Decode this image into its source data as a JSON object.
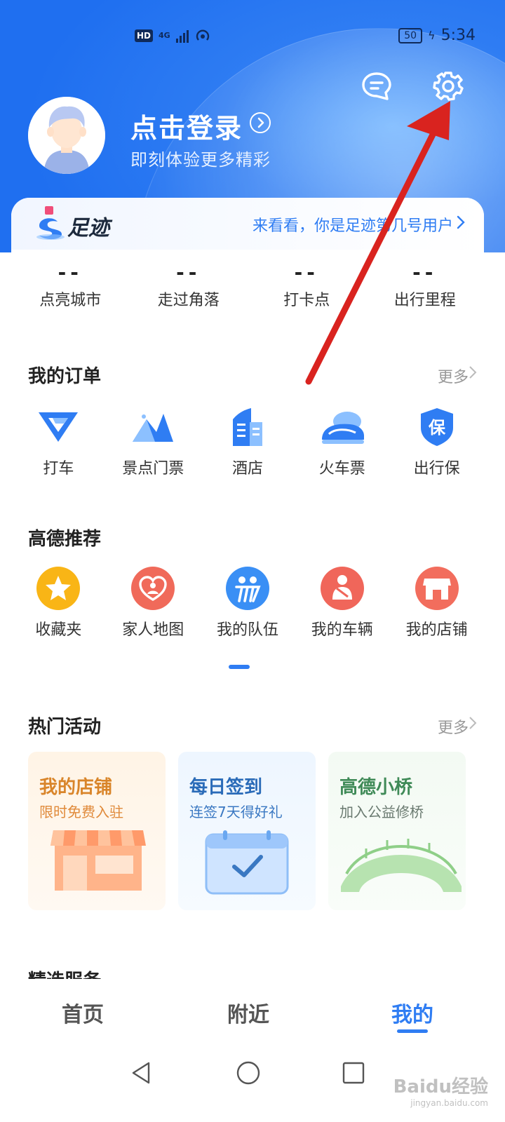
{
  "status_bar": {
    "time": "5:34",
    "battery": "50",
    "hd": "HD",
    "network": "4G"
  },
  "header": {
    "login_title": "点击登录",
    "login_subtitle": "即刻体验更多精彩"
  },
  "footprint": {
    "title": "足迹",
    "link": "来看看，你是足迹第几号用户",
    "stats": [
      {
        "value": "--",
        "label": "点亮城市"
      },
      {
        "value": "--",
        "label": "走过角落"
      },
      {
        "value": "--",
        "label": "打卡点"
      },
      {
        "value": "--",
        "label": "出行里程"
      }
    ]
  },
  "orders": {
    "title": "我的订单",
    "more": "更多",
    "items": [
      {
        "label": "打车",
        "icon": "taxi-icon"
      },
      {
        "label": "景点门票",
        "icon": "mountain-icon"
      },
      {
        "label": "酒店",
        "icon": "hotel-icon"
      },
      {
        "label": "火车票",
        "icon": "train-icon"
      },
      {
        "label": "出行保",
        "icon": "insurance-icon"
      }
    ]
  },
  "recommend": {
    "title": "高德推荐",
    "items": [
      {
        "label": "收藏夹",
        "icon": "star-icon",
        "color": "#f9b516"
      },
      {
        "label": "家人地图",
        "icon": "family-heart-icon",
        "color": "#f06a5a"
      },
      {
        "label": "我的队伍",
        "icon": "team-icon",
        "color": "#3a8ff5"
      },
      {
        "label": "我的车辆",
        "icon": "driver-icon",
        "color": "#f0665a"
      },
      {
        "label": "我的店铺",
        "icon": "shop-icon",
        "color": "#f26d5d"
      }
    ]
  },
  "activities": {
    "title": "热门活动",
    "more": "更多",
    "cards": [
      {
        "title": "我的店铺",
        "subtitle": "限时免费入驻",
        "title_color": "#d9852a",
        "sub_color": "#e08a3a"
      },
      {
        "title": "每日签到",
        "subtitle": "连签7天得好礼",
        "title_color": "#2a6bb8",
        "sub_color": "#3a78c2"
      },
      {
        "title": "高德小桥",
        "subtitle": "加入公益修桥",
        "title_color": "#3f8a57",
        "sub_color": "#6a7a70"
      }
    ]
  },
  "next_section_title": "精选服务",
  "tabs": [
    {
      "label": "首页",
      "active": false
    },
    {
      "label": "附近",
      "active": false
    },
    {
      "label": "我的",
      "active": true
    }
  ],
  "watermark": {
    "text": "Baidu经验",
    "sub": "jingyan.baidu.com"
  },
  "colors": {
    "brand": "#2f7df3",
    "annotation": "#d9231f"
  }
}
